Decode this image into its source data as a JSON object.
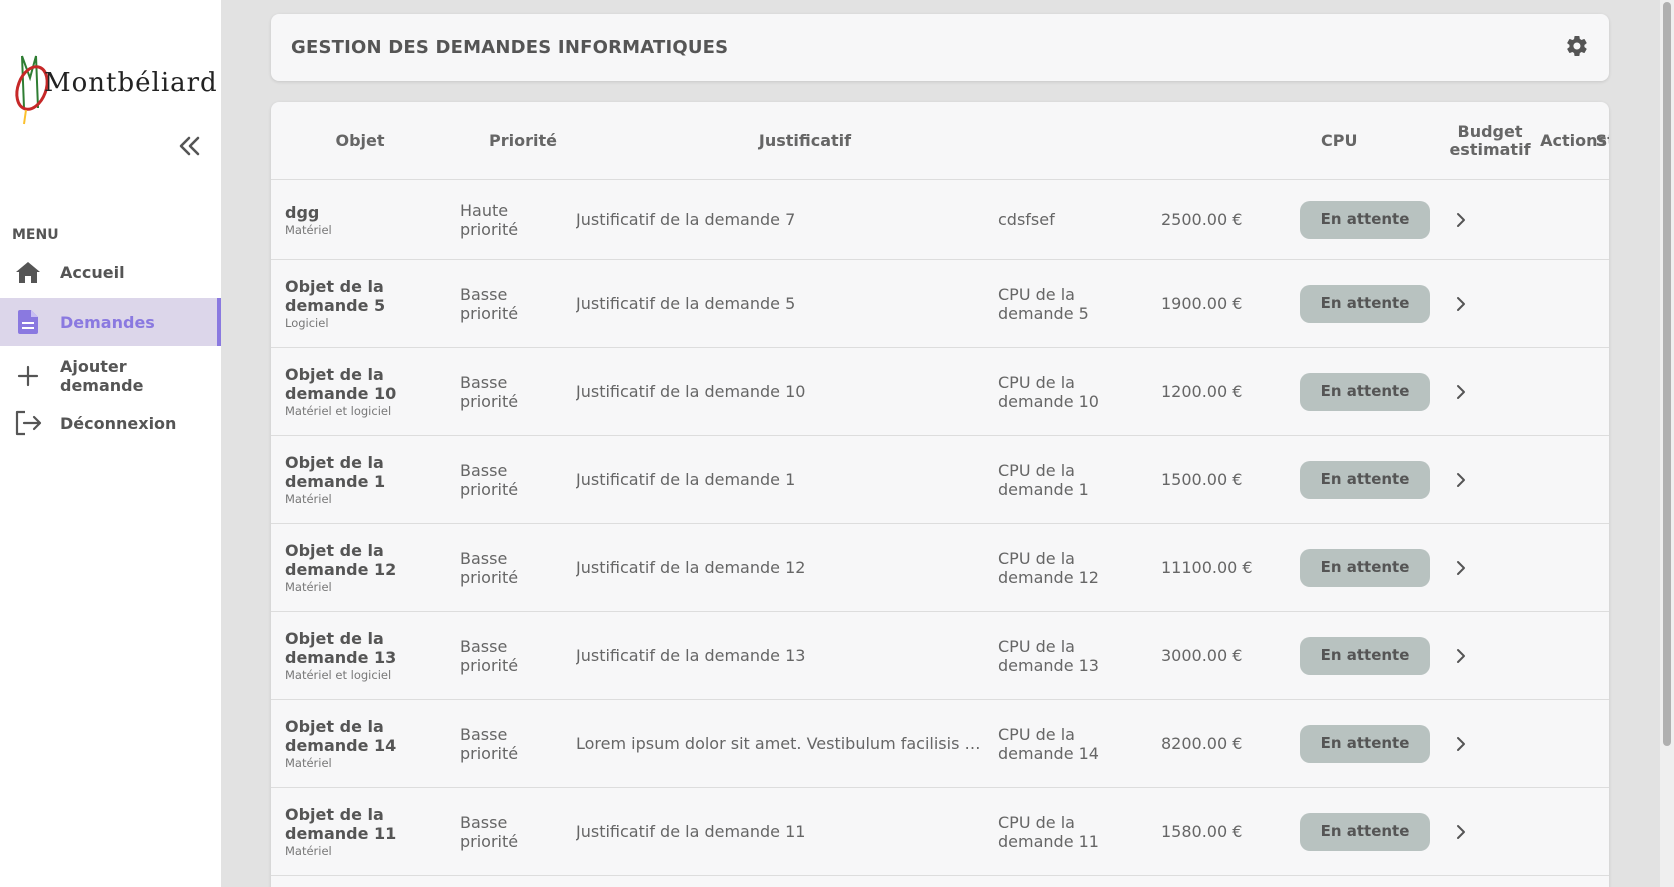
{
  "sidebar": {
    "logo_text": "Montbéliard",
    "menu_label": "MENU",
    "items": [
      {
        "label": "Accueil",
        "icon": "home-icon",
        "active": false
      },
      {
        "label": "Demandes",
        "icon": "document-icon",
        "active": true
      },
      {
        "label": "Ajouter demande",
        "icon": "plus-icon",
        "active": false
      },
      {
        "label": "Déconnexion",
        "icon": "logout-icon",
        "active": false
      }
    ]
  },
  "header": {
    "title": "GESTION DES DEMANDES INFORMATIQUES",
    "settings_icon": "gear-icon"
  },
  "table": {
    "columns": [
      "Objet",
      "Priorité",
      "Justificatif",
      "CPU",
      "Budget estimatif",
      "Statut",
      "Actions"
    ],
    "rows": [
      {
        "objet": "dgg",
        "type": "Matériel",
        "priorite": "Haute priorité",
        "justificatif": "Justificatif de la demande 7",
        "cpu": "cdsfsef",
        "budget": "2500.00 €",
        "statut": "En attente"
      },
      {
        "objet": "Objet de la demande 5",
        "type": "Logiciel",
        "priorite": "Basse priorité",
        "justificatif": "Justificatif de la demande 5",
        "cpu": "CPU de la demande 5",
        "budget": "1900.00 €",
        "statut": "En attente"
      },
      {
        "objet": "Objet de la demande 10",
        "type": "Matériel et logiciel",
        "priorite": "Basse priorité",
        "justificatif": "Justificatif de la demande 10",
        "cpu": "CPU de la demande 10",
        "budget": "1200.00 €",
        "statut": "En attente"
      },
      {
        "objet": "Objet de la demande 1",
        "type": "Matériel",
        "priorite": "Basse priorité",
        "justificatif": "Justificatif de la demande 1",
        "cpu": "CPU de la demande 1",
        "budget": "1500.00 €",
        "statut": "En attente"
      },
      {
        "objet": "Objet de la demande 12",
        "type": "Matériel",
        "priorite": "Basse priorité",
        "justificatif": "Justificatif de la demande 12",
        "cpu": "CPU de la demande 12",
        "budget": "11100.00 €",
        "statut": "En attente"
      },
      {
        "objet": "Objet de la demande 13",
        "type": "Matériel et logiciel",
        "priorite": "Basse priorité",
        "justificatif": "Justificatif de la demande 13",
        "cpu": "CPU de la demande 13",
        "budget": "3000.00 €",
        "statut": "En attente"
      },
      {
        "objet": "Objet de la demande 14",
        "type": "Matériel",
        "priorite": "Basse priorité",
        "justificatif": "Lorem ipsum dolor sit amet. Vestibulum facilisis te...",
        "cpu": "CPU de la demande 14",
        "budget": "8200.00 €",
        "statut": "En attente"
      },
      {
        "objet": "Objet de la demande 11",
        "type": "Matériel",
        "priorite": "Basse priorité",
        "justificatif": "Justificatif de la demande 11",
        "cpu": "CPU de la demande 11",
        "budget": "1580.00 €",
        "statut": "En attente"
      }
    ]
  },
  "colors": {
    "accent": "#8a79e0",
    "active_bg": "#dcd6ea",
    "status_bg": "#b8c2c0",
    "page_bg": "#e2e2e2"
  }
}
